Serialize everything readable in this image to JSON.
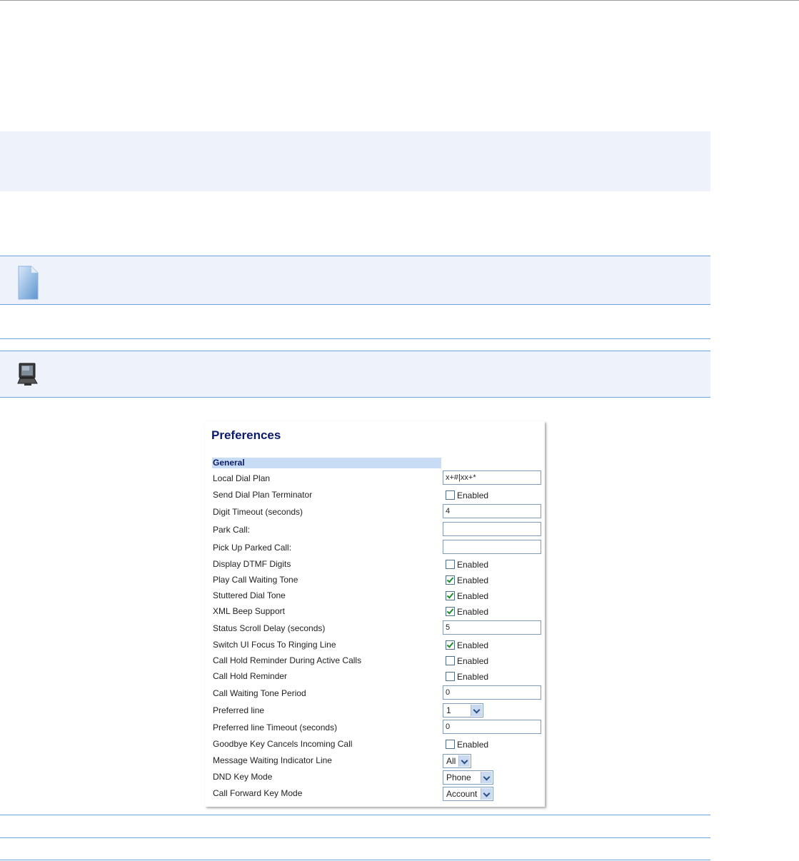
{
  "preferences": {
    "title": "Preferences",
    "section": "General",
    "rows": {
      "local_dial_plan": {
        "label": "Local Dial Plan",
        "value": "x+#|xx+*"
      },
      "send_dial_plan_terminator": {
        "label": "Send Dial Plan Terminator",
        "checkbox_label": "Enabled",
        "checked": false
      },
      "digit_timeout": {
        "label": "Digit Timeout (seconds)",
        "value": "4"
      },
      "park_call": {
        "label": "Park Call:",
        "value": ""
      },
      "pick_up_parked_call": {
        "label": "Pick Up Parked Call:",
        "value": ""
      },
      "display_dtmf_digits": {
        "label": "Display DTMF Digits",
        "checkbox_label": "Enabled",
        "checked": false
      },
      "play_call_waiting_tone": {
        "label": "Play Call Waiting Tone",
        "checkbox_label": "Enabled",
        "checked": true
      },
      "stuttered_dial_tone": {
        "label": "Stuttered Dial Tone",
        "checkbox_label": "Enabled",
        "checked": true
      },
      "xml_beep_support": {
        "label": "XML Beep Support",
        "checkbox_label": "Enabled",
        "checked": true
      },
      "status_scroll_delay": {
        "label": "Status Scroll Delay (seconds)",
        "value": "5"
      },
      "switch_ui_focus": {
        "label": "Switch UI Focus To Ringing Line",
        "checkbox_label": "Enabled",
        "checked": true
      },
      "call_hold_reminder_active": {
        "label": "Call Hold Reminder During Active Calls",
        "checkbox_label": "Enabled",
        "checked": false
      },
      "call_hold_reminder": {
        "label": "Call Hold Reminder",
        "checkbox_label": "Enabled",
        "checked": false
      },
      "call_waiting_tone_period": {
        "label": "Call Waiting Tone Period",
        "value": "0"
      },
      "preferred_line": {
        "label": "Preferred line",
        "selected": "1"
      },
      "preferred_line_timeout": {
        "label": "Preferred line Timeout (seconds)",
        "value": "0"
      },
      "goodbye_key_cancels": {
        "label": "Goodbye Key Cancels Incoming Call",
        "checkbox_label": "Enabled",
        "checked": false
      },
      "mwi_line": {
        "label": "Message Waiting Indicator Line",
        "selected": "All"
      },
      "dnd_key_mode": {
        "label": "DND Key Mode",
        "selected": "Phone"
      },
      "call_forward_key_mode": {
        "label": "Call Forward Key Mode",
        "selected": "Account"
      }
    }
  },
  "icons": {
    "note": "note-document-icon",
    "web_ui": "computer-monitor-icon"
  },
  "colors": {
    "accent_line": "#6fa2d8",
    "band_bg": "#eef3fb",
    "section_bg": "#c8ddf5",
    "title_color": "#0b1a6b"
  }
}
